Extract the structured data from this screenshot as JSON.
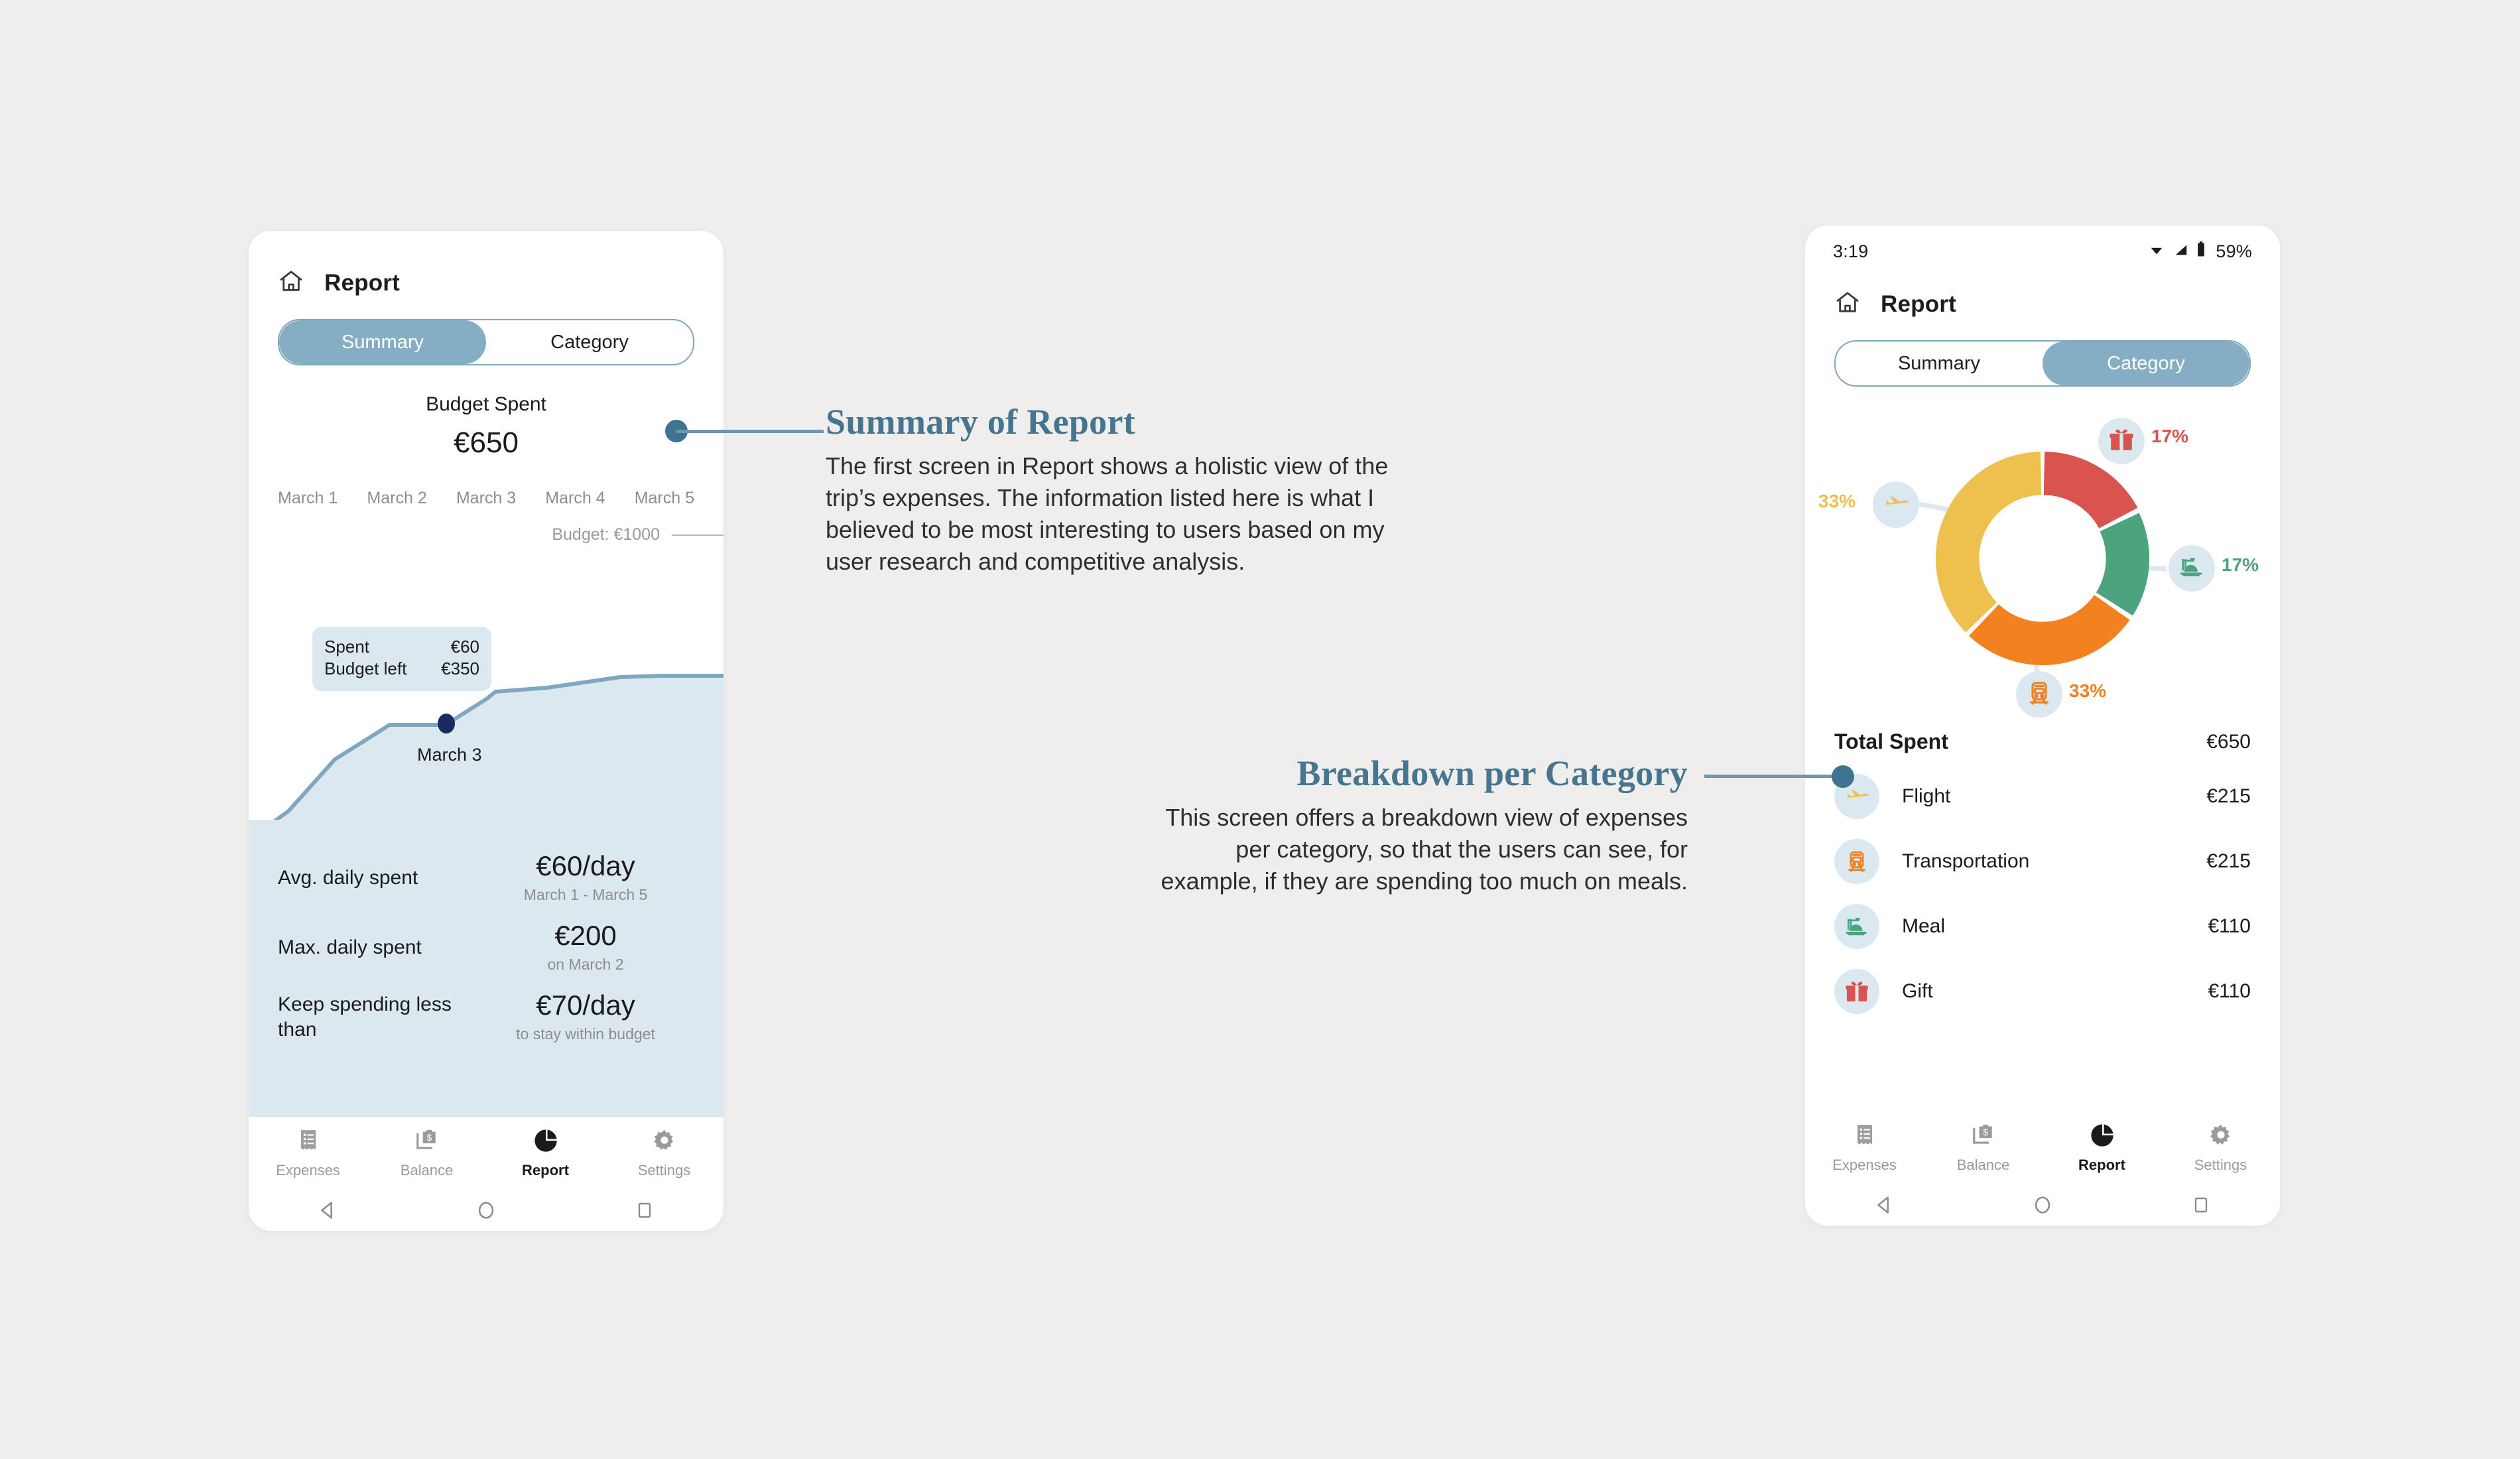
{
  "canvas": {
    "background": "#efeeec"
  },
  "theme": {
    "accent": "#46768f",
    "leader": "#6e97ae",
    "dot": "#3f7490",
    "tab_active_bg": "#85aec4",
    "tab_border": "#7fa7bd",
    "panel_bg": "#dce8ef",
    "chart_line": "#7fa8c0",
    "chart_fill": "#dce8ef",
    "marker": "#1b2a62"
  },
  "phone_left": {
    "appbar": {
      "home_icon": "home-icon",
      "title": "Report"
    },
    "tabs": [
      {
        "label": "Summary",
        "active": true
      },
      {
        "label": "Category",
        "active": false
      }
    ],
    "budget": {
      "label": "Budget Spent",
      "value": "€650"
    },
    "dates": [
      "March 1",
      "March 2",
      "March 3",
      "March 4",
      "March 5"
    ],
    "budget_line_label": "Budget: €1000",
    "tooltip": {
      "rows": [
        {
          "label": "Spent",
          "value": "€60"
        },
        {
          "label": "Budget left",
          "value": "€350"
        }
      ],
      "point_label": "March 3"
    },
    "stats": [
      {
        "label": "Avg. daily spent",
        "value": "€60/day",
        "sub": "March 1 - March 5"
      },
      {
        "label": "Max. daily spent",
        "value": "€200",
        "sub": "on March 2"
      },
      {
        "label": "Keep spending less than",
        "value": "€70/day",
        "sub": "to stay within budget"
      }
    ],
    "bottom_nav": [
      {
        "label": "Expenses",
        "icon": "receipt-icon",
        "active": false
      },
      {
        "label": "Balance",
        "icon": "briefcase-dollar-icon",
        "active": false
      },
      {
        "label": "Report",
        "icon": "pie-chart-icon",
        "active": true
      },
      {
        "label": "Settings",
        "icon": "gear-icon",
        "active": false
      }
    ],
    "system_keys": [
      "back-triangle-icon",
      "home-circle-icon",
      "recents-square-icon"
    ]
  },
  "phone_right": {
    "statusbar": {
      "time": "3:19",
      "wifi_icon": "wifi-icon",
      "signal_icon": "signal-icon",
      "battery_icon": "battery-icon",
      "battery_pct": "59%"
    },
    "appbar": {
      "home_icon": "home-icon",
      "title": "Report"
    },
    "tabs": [
      {
        "label": "Summary",
        "active": false
      },
      {
        "label": "Category",
        "active": true
      }
    ],
    "total": {
      "label": "Total Spent",
      "value": "€650"
    },
    "categories": [
      {
        "name": "Flight",
        "amount": "€215",
        "icon": "plane-icon",
        "color": "#eec14f"
      },
      {
        "name": "Transportation",
        "amount": "€215",
        "icon": "train-icon",
        "color": "#f4811f"
      },
      {
        "name": "Meal",
        "amount": "€110",
        "icon": "meal-dome-icon",
        "color": "#4ba47e"
      },
      {
        "name": "Gift",
        "amount": "€110",
        "icon": "gift-icon",
        "color": "#d9534f"
      }
    ],
    "bottom_nav": [
      {
        "label": "Expenses",
        "icon": "receipt-icon",
        "active": false
      },
      {
        "label": "Balance",
        "icon": "briefcase-dollar-icon",
        "active": false
      },
      {
        "label": "Report",
        "icon": "pie-chart-icon",
        "active": true
      },
      {
        "label": "Settings",
        "icon": "gear-icon",
        "active": false
      }
    ],
    "system_keys": [
      "back-triangle-icon",
      "home-circle-icon",
      "recents-square-icon"
    ]
  },
  "annotations": [
    {
      "title": "Summary of Report",
      "body": "The first screen in Report shows a holistic view of the trip’s expenses. The information listed here is what I believed to be most interesting to users based on my user research and competitive analysis."
    },
    {
      "title": "Breakdown per Category",
      "body": "This screen offers a breakdown view of expenses per category, so that the users can see, for example, if they are spending too much on meals."
    }
  ],
  "chart_data": [
    {
      "type": "area",
      "title": "Budget Spent",
      "xlabel": "",
      "ylabel": "",
      "categories": [
        "March 1",
        "March 2",
        "March 3",
        "March 4",
        "March 5"
      ],
      "values": [
        120,
        320,
        380,
        560,
        650
      ],
      "annotations": {
        "budget_reference": 1000,
        "budget_reference_label": "Budget: €1000",
        "highlight_point": "March 3",
        "highlight_spent": "€60",
        "highlight_budget_left": "€350"
      },
      "grid": false,
      "legend": "none"
    },
    {
      "type": "pie",
      "title": "Breakdown per Category",
      "labels": [
        "Gift",
        "Meal",
        "Transportation",
        "Flight"
      ],
      "values": [
        17,
        17,
        33,
        33
      ],
      "value_labels": [
        "17%",
        "17%",
        "33%",
        "33%"
      ],
      "amounts": [
        "€110",
        "€110",
        "€215",
        "€215"
      ],
      "colors": [
        "#d9534f",
        "#4ba47e",
        "#f4811f",
        "#eec14f"
      ],
      "total_label": "Total Spent",
      "total_value": "€650",
      "donut": true,
      "legend": "callouts"
    }
  ]
}
